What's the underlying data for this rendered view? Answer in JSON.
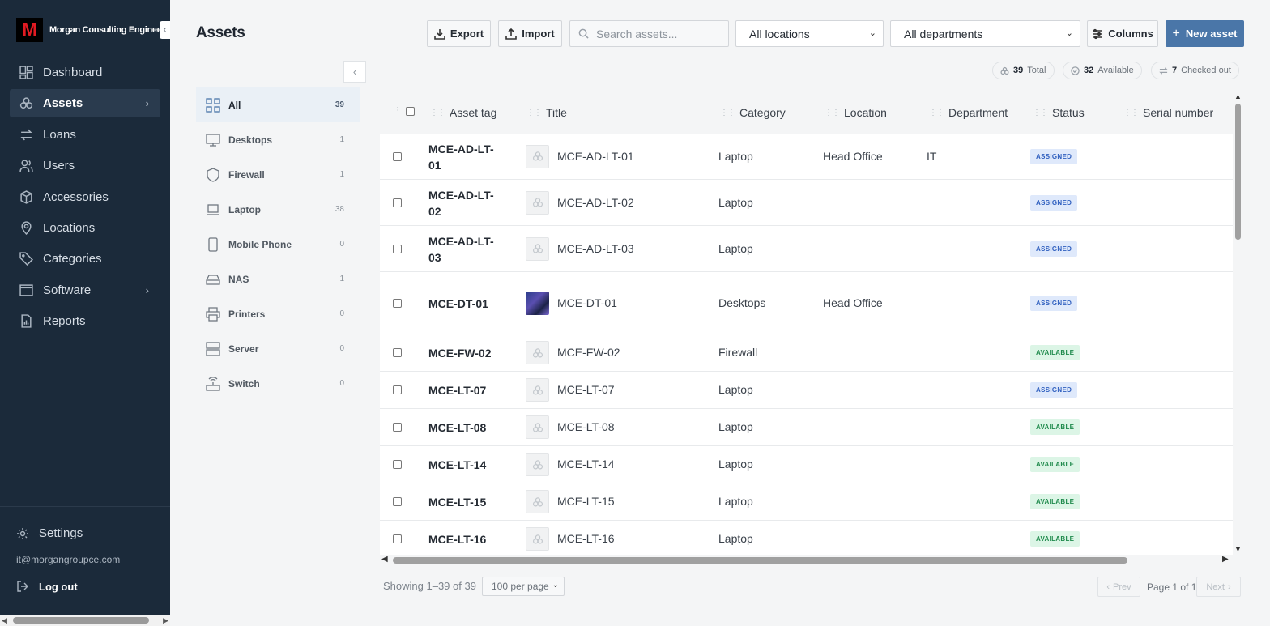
{
  "sidebar": {
    "brand": "Morgan Consulting Engineers",
    "logo_letter": "M",
    "collapse_glyph": "‹",
    "items": [
      {
        "label": "Dashboard",
        "icon": "dashboard-icon"
      },
      {
        "label": "Assets",
        "icon": "assets-icon",
        "active": true,
        "has_children": true
      },
      {
        "label": "Loans",
        "icon": "loans-icon"
      },
      {
        "label": "Users",
        "icon": "users-icon"
      },
      {
        "label": "Accessories",
        "icon": "box-icon"
      },
      {
        "label": "Locations",
        "icon": "location-pin-icon"
      },
      {
        "label": "Categories",
        "icon": "tag-icon"
      },
      {
        "label": "Software",
        "icon": "software-icon",
        "has_children": true
      },
      {
        "label": "Reports",
        "icon": "report-icon"
      }
    ],
    "settings": "Settings",
    "email": "it@morgangroupce.com",
    "logout": "Log out"
  },
  "header": {
    "title": "Assets",
    "export_label": "Export",
    "import_label": "Import",
    "search_placeholder": "Search assets...",
    "location_filter": "All locations",
    "department_filter": "All departments",
    "columns_label": "Columns",
    "new_asset_label": "New asset"
  },
  "stats": {
    "total_count": "39",
    "total_label": "Total",
    "available_count": "32",
    "available_label": "Available",
    "checked_out_count": "7",
    "checked_out_label": "Checked out"
  },
  "categories": [
    {
      "label": "All",
      "count": "39",
      "icon": "grid-icon",
      "active": true
    },
    {
      "label": "Desktops",
      "count": "1",
      "icon": "monitor-icon"
    },
    {
      "label": "Firewall",
      "count": "1",
      "icon": "shield-icon"
    },
    {
      "label": "Laptop",
      "count": "38",
      "icon": "laptop-icon"
    },
    {
      "label": "Mobile Phone",
      "count": "0",
      "icon": "phone-icon"
    },
    {
      "label": "NAS",
      "count": "1",
      "icon": "nas-icon"
    },
    {
      "label": "Printers",
      "count": "0",
      "icon": "printer-icon"
    },
    {
      "label": "Server",
      "count": "0",
      "icon": "server-icon"
    },
    {
      "label": "Switch",
      "count": "0",
      "icon": "switch-icon"
    }
  ],
  "table": {
    "columns": [
      "Asset tag",
      "Title",
      "Category",
      "Location",
      "Department",
      "Status",
      "Serial number"
    ],
    "rows": [
      {
        "tag": "MCE-AD-LT-01",
        "tag_lines": [
          "MCE-AD-LT-",
          "01"
        ],
        "title": "MCE-AD-LT-01",
        "category": "Laptop",
        "location": "Head Office",
        "department": "IT",
        "status": "ASSIGNED",
        "serial": ""
      },
      {
        "tag": "MCE-AD-LT-02",
        "tag_lines": [
          "MCE-AD-LT-",
          "02"
        ],
        "title": "MCE-AD-LT-02",
        "category": "Laptop",
        "location": "",
        "department": "",
        "status": "ASSIGNED",
        "serial": ""
      },
      {
        "tag": "MCE-AD-LT-03",
        "tag_lines": [
          "MCE-AD-LT-",
          "03"
        ],
        "title": "MCE-AD-LT-03",
        "category": "Laptop",
        "location": "",
        "department": "",
        "status": "ASSIGNED",
        "serial": ""
      },
      {
        "tag": "MCE-DT-01",
        "tag_lines": [
          "MCE-DT-01"
        ],
        "title": "MCE-DT-01",
        "category": "Desktops",
        "location": "Head Office",
        "department": "",
        "status": "ASSIGNED",
        "serial": "",
        "has_image": true
      },
      {
        "tag": "MCE-FW-02",
        "tag_lines": [
          "MCE-FW-02"
        ],
        "title": "MCE-FW-02",
        "category": "Firewall",
        "location": "",
        "department": "",
        "status": "AVAILABLE",
        "serial": ""
      },
      {
        "tag": "MCE-LT-07",
        "tag_lines": [
          "MCE-LT-07"
        ],
        "title": "MCE-LT-07",
        "category": "Laptop",
        "location": "",
        "department": "",
        "status": "ASSIGNED",
        "serial": ""
      },
      {
        "tag": "MCE-LT-08",
        "tag_lines": [
          "MCE-LT-08"
        ],
        "title": "MCE-LT-08",
        "category": "Laptop",
        "location": "",
        "department": "",
        "status": "AVAILABLE",
        "serial": ""
      },
      {
        "tag": "MCE-LT-14",
        "tag_lines": [
          "MCE-LT-14"
        ],
        "title": "MCE-LT-14",
        "category": "Laptop",
        "location": "",
        "department": "",
        "status": "AVAILABLE",
        "serial": ""
      },
      {
        "tag": "MCE-LT-15",
        "tag_lines": [
          "MCE-LT-15"
        ],
        "title": "MCE-LT-15",
        "category": "Laptop",
        "location": "",
        "department": "",
        "status": "AVAILABLE",
        "serial": ""
      },
      {
        "tag": "MCE-LT-16",
        "tag_lines": [
          "MCE-LT-16"
        ],
        "title": "MCE-LT-16",
        "category": "Laptop",
        "location": "",
        "department": "",
        "status": "AVAILABLE",
        "serial": ""
      }
    ]
  },
  "footer": {
    "showing": "Showing 1–39 of 39",
    "per_page": "100 per page",
    "prev": "Prev",
    "page_info": "Page 1 of 1",
    "next": "Next"
  },
  "colors": {
    "sidebar_bg": "#1b2a3a",
    "primary": "#4a76a8",
    "assigned": "#2f5fbf",
    "available": "#1f8a4c",
    "logo_red": "#e11b22"
  }
}
